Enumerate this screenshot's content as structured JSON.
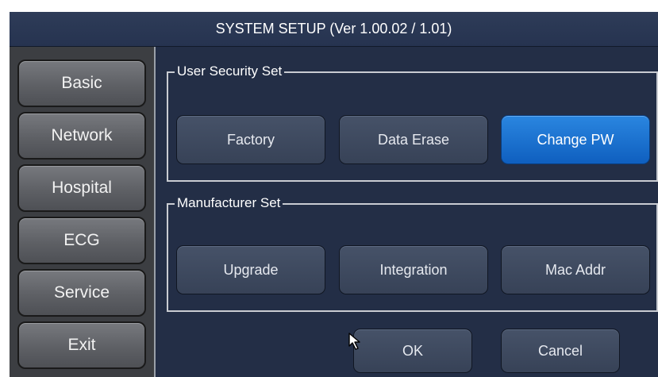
{
  "window": {
    "title": "SYSTEM SETUP (Ver 1.00.02 / 1.01)"
  },
  "sidebar": {
    "items": [
      {
        "label": "Basic"
      },
      {
        "label": "Network"
      },
      {
        "label": "Hospital"
      },
      {
        "label": "ECG"
      },
      {
        "label": "Service"
      },
      {
        "label": "Exit"
      }
    ]
  },
  "user_security": {
    "title": "User Security Set",
    "buttons": [
      {
        "label": "Factory"
      },
      {
        "label": "Data Erase"
      },
      {
        "label": "Change PW",
        "selected": true
      }
    ]
  },
  "manufacturer": {
    "title": "Manufacturer Set",
    "buttons": [
      {
        "label": "Upgrade"
      },
      {
        "label": "Integration"
      },
      {
        "label": "Mac Addr"
      }
    ]
  },
  "footer": {
    "ok_label": "OK",
    "cancel_label": "Cancel"
  },
  "colors": {
    "title_bar": "#2e3c58",
    "panel_bg": "#232e46",
    "selected_button": "#1a72d0"
  },
  "icons": {
    "cursor": "mouse-pointer-icon"
  }
}
